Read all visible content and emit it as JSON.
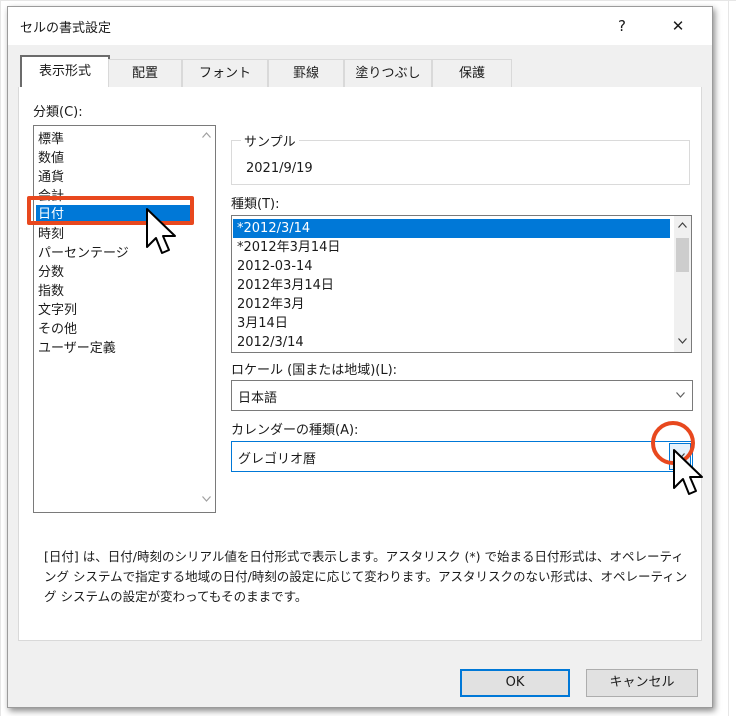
{
  "window": {
    "title": "セルの書式設定",
    "help_label": "?",
    "close_label": "✕"
  },
  "tabs": [
    {
      "label": "表示形式",
      "active": true
    },
    {
      "label": "配置"
    },
    {
      "label": "フォント"
    },
    {
      "label": "罫線"
    },
    {
      "label": "塗りつぶし"
    },
    {
      "label": "保護"
    }
  ],
  "category": {
    "label": "分類(C):",
    "items": [
      "標準",
      "数値",
      "通貨",
      "会計",
      "日付",
      "時刻",
      "パーセンテージ",
      "分数",
      "指数",
      "文字列",
      "その他",
      "ユーザー定義"
    ],
    "selected_index": 4
  },
  "sample": {
    "label": "サンプル",
    "value": "2021/9/19"
  },
  "type": {
    "label": "種類(T):",
    "items": [
      "*2012/3/14",
      "*2012年3月14日",
      "2012-03-14",
      "2012年3月14日",
      "2012年3月",
      "3月14日",
      "2012/3/14"
    ],
    "selected_index": 0
  },
  "locale": {
    "label": "ロケール (国または地域)(L):",
    "value": "日本語"
  },
  "calendar": {
    "label": "カレンダーの種類(A):",
    "value": "グレゴリオ暦"
  },
  "description": "[日付] は、日付/時刻のシリアル値を日付形式で表示します。アスタリスク (*) で始まる日付形式は、オペレーティング システムで指定する地域の日付/時刻の設定に応じて変わります。アスタリスクのない形式は、オペレーティング システムの設定が変わってもそのままです。",
  "buttons": {
    "ok": "OK",
    "cancel": "キャンセル"
  },
  "icons": {
    "scroll_up": "chevron-up-icon",
    "scroll_down": "chevron-down-icon",
    "dropdown": "chevron-down-icon",
    "pointer": "mouse-pointer-icon"
  },
  "colors": {
    "selection": "#0078d7",
    "highlight": "#e8481e",
    "dialog_bg": "#f0f0f0"
  }
}
